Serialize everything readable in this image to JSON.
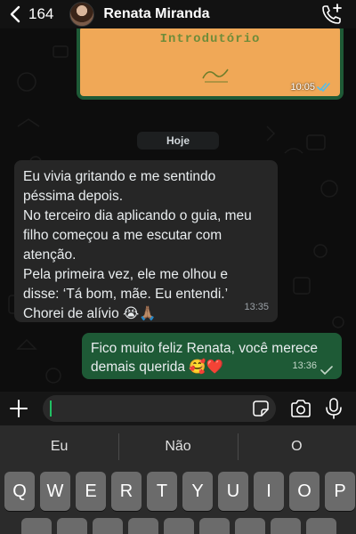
{
  "header": {
    "back_count": "164",
    "contact_name": "Renata Miranda"
  },
  "chat": {
    "image_message": {
      "image_text": "Introdutório",
      "time": "10:05"
    },
    "date_chip": "Hoje",
    "incoming_message": {
      "text": "Eu vivia gritando e me sentindo\npéssima depois.\nNo terceiro dia aplicando o guia, meu\nfilho começou a me escutar com\natenção.\nPela primeira vez, ele me olhou e\ndisse: ‘Tá bom, mãe. Eu entendi.’\nChorei de alívio 😭🙏🏽",
      "time": "13:35"
    },
    "outgoing_message": {
      "text": "Fico muito feliz Renata, você merece\ndemais querida 🥰❤️",
      "time": "13:36"
    }
  },
  "keyboard": {
    "suggestions": [
      "Eu",
      "Não",
      "O"
    ],
    "row1": [
      "Q",
      "W",
      "E",
      "R",
      "T",
      "Y",
      "U",
      "I",
      "O",
      "P"
    ]
  },
  "colors": {
    "accent": "#21c063",
    "outgoing_bubble": "#1e5a36",
    "incoming_bubble": "#262626",
    "read_ticks": "#53bdeb"
  }
}
